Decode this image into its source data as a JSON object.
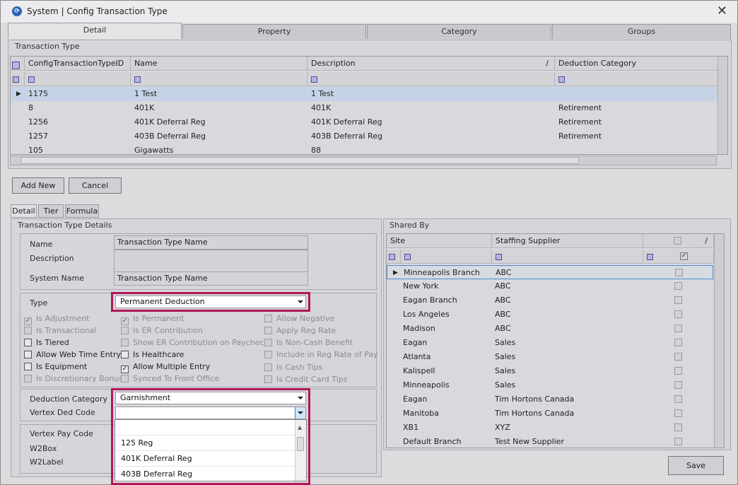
{
  "window": {
    "title": "System | Config Transaction Type",
    "close_icon": "close-icon"
  },
  "top_tabs": [
    "Detail",
    "Property",
    "Category",
    "Groups"
  ],
  "tx_grid": {
    "group_label": "Transaction Type",
    "columns": [
      "ConfigTransactionTypeID",
      "Name",
      "Description",
      "Deduction Category"
    ],
    "sort_mark": "/",
    "rows": [
      [
        "1175",
        "1 Test",
        "1 Test",
        ""
      ],
      [
        "8",
        "401K",
        "401K",
        "Retirement"
      ],
      [
        "1256",
        "401K Deferral Reg",
        "401K Deferral Reg",
        "Retirement"
      ],
      [
        "1257",
        "403B Deferral Reg",
        "403B Deferral Reg",
        "Retirement"
      ],
      [
        "105",
        "Gigawatts",
        "88",
        ""
      ]
    ]
  },
  "buttons": {
    "add_new": "Add New",
    "cancel": "Cancel",
    "save": "Save"
  },
  "sub_tabs": [
    "Detail",
    "Tier",
    "Formula"
  ],
  "details": {
    "group_label": "Transaction Type Details",
    "name_label": "Name",
    "name_value": "Transaction Type Name",
    "description_label": "Description",
    "description_value": "",
    "system_name_label": "System Name",
    "system_name_value": "Transaction Type Name",
    "type_label": "Type",
    "type_value": "Permanent Deduction",
    "deduction_category_label": "Deduction Category",
    "deduction_category_value": "Garnishment",
    "vertex_ded_label": "Vertex Ded Code",
    "vertex_ded_value": "",
    "vertex_pay_label": "Vertex Pay Code",
    "w2box_label": "W2Box",
    "w2label_label": "W2Label"
  },
  "checkboxes": [
    {
      "label": "Is Adjustment",
      "checked": true,
      "enabled": false
    },
    {
      "label": "Is Transactional",
      "checked": false,
      "enabled": false
    },
    {
      "label": "Is Tiered",
      "checked": false,
      "enabled": true
    },
    {
      "label": "Allow Web Time Entry",
      "checked": false,
      "enabled": true
    },
    {
      "label": "Is Equipment",
      "checked": false,
      "enabled": true
    },
    {
      "label": "Is Discretionary Bonus",
      "checked": false,
      "enabled": false
    },
    {
      "label": "Is Permanent",
      "checked": true,
      "enabled": false
    },
    {
      "label": "Is ER Contribution",
      "checked": false,
      "enabled": false
    },
    {
      "label": "Show ER Contribution on Paycheck",
      "checked": false,
      "enabled": false
    },
    {
      "label": "Is Healthcare",
      "checked": false,
      "enabled": true
    },
    {
      "label": "Allow Multiple Entry",
      "checked": true,
      "enabled": true
    },
    {
      "label": "Synced To Front Office",
      "checked": false,
      "enabled": false
    },
    {
      "label": "Allow Negative",
      "checked": false,
      "enabled": false
    },
    {
      "label": "Apply Reg Rate",
      "checked": false,
      "enabled": false
    },
    {
      "label": "Is Non-Cash Benefit",
      "checked": false,
      "enabled": false
    },
    {
      "label": "Include in Reg Rate of Pay",
      "checked": false,
      "enabled": false
    },
    {
      "label": "Is Cash Tips",
      "checked": false,
      "enabled": false
    },
    {
      "label": "Is Credit Card Tips",
      "checked": false,
      "enabled": false
    }
  ],
  "dropdown_options": [
    "",
    "125 Reg",
    "401K Deferral Reg",
    "403B Deferral Reg"
  ],
  "shared_by": {
    "group_label": "Shared By",
    "columns": [
      "Site",
      "Staffing Supplier"
    ],
    "rows": [
      [
        "Minneapolis Branch",
        "ABC"
      ],
      [
        "New York",
        "ABC"
      ],
      [
        "Eagan Branch",
        "ABC"
      ],
      [
        "Los Angeles",
        "ABC"
      ],
      [
        "Madison",
        "ABC"
      ],
      [
        "Eagan",
        "Sales"
      ],
      [
        "Atlanta",
        "Sales"
      ],
      [
        "Kalispell",
        "Sales"
      ],
      [
        "Minneapolis",
        "Sales"
      ],
      [
        "Eagan",
        "Tim Hortons Canada"
      ],
      [
        "Manitoba",
        "Tim Hortons Canada"
      ],
      [
        "XB1",
        "XYZ"
      ],
      [
        "Default Branch",
        "Test New Supplier"
      ]
    ]
  },
  "colors": {
    "highlight": "#b0185c",
    "selected_row": "#c4d4e6"
  }
}
